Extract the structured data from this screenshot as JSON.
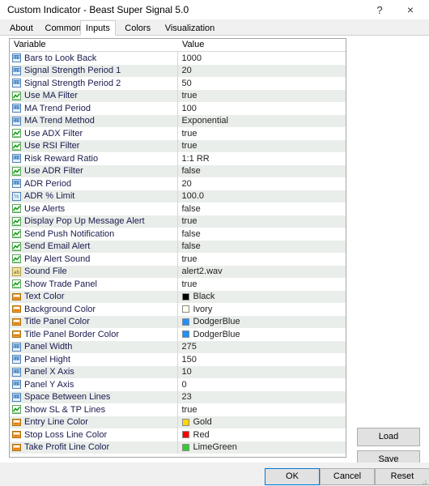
{
  "window": {
    "title": "Custom Indicator - Beast Super Signal 5.0",
    "help_label": "?",
    "close_label": "×"
  },
  "tabs": [
    {
      "label": "About",
      "active": false
    },
    {
      "label": "Common",
      "active": false
    },
    {
      "label": "Inputs",
      "active": true
    },
    {
      "label": "Colors",
      "active": false
    },
    {
      "label": "Visualization",
      "active": false
    }
  ],
  "grid": {
    "headers": {
      "variable": "Variable",
      "value": "Value"
    },
    "rows": [
      {
        "icon": "integer-icon",
        "variable": "Bars to Look Back",
        "value": "1000"
      },
      {
        "icon": "integer-icon",
        "variable": "Signal Strength Period 1",
        "value": "20"
      },
      {
        "icon": "integer-icon",
        "variable": "Signal Strength Period 2",
        "value": "50"
      },
      {
        "icon": "boolean-icon",
        "variable": "Use MA Filter",
        "value": "true"
      },
      {
        "icon": "integer-icon",
        "variable": "MA Trend Period",
        "value": "100"
      },
      {
        "icon": "integer-icon",
        "variable": "MA Trend Method",
        "value": "Exponential"
      },
      {
        "icon": "boolean-icon",
        "variable": "Use ADX Filter",
        "value": "true"
      },
      {
        "icon": "boolean-icon",
        "variable": "Use RSI Filter",
        "value": "true"
      },
      {
        "icon": "integer-icon",
        "variable": "Risk Reward Ratio",
        "value": "1:1 RR"
      },
      {
        "icon": "boolean-icon",
        "variable": "Use ADR Filter",
        "value": "false"
      },
      {
        "icon": "integer-icon",
        "variable": "ADR Period",
        "value": "20"
      },
      {
        "icon": "double-icon",
        "variable": "ADR % Limit",
        "value": "100.0"
      },
      {
        "icon": "boolean-icon",
        "variable": "Use Alerts",
        "value": "false"
      },
      {
        "icon": "boolean-icon",
        "variable": "Display Pop Up Message Alert",
        "value": "true"
      },
      {
        "icon": "boolean-icon",
        "variable": "Send Push Notification",
        "value": "false"
      },
      {
        "icon": "boolean-icon",
        "variable": "Send Email Alert",
        "value": "false"
      },
      {
        "icon": "boolean-icon",
        "variable": "Play Alert Sound",
        "value": "true"
      },
      {
        "icon": "string-icon",
        "variable": "Sound File",
        "value": "alert2.wav"
      },
      {
        "icon": "boolean-icon",
        "variable": "Show Trade Panel",
        "value": "true"
      },
      {
        "icon": "color-icon",
        "variable": "Text Color",
        "value": "Black",
        "swatch": "#000000"
      },
      {
        "icon": "color-icon",
        "variable": "Background Color",
        "value": "Ivory",
        "swatch": "#fffff0"
      },
      {
        "icon": "color-icon",
        "variable": "Title Panel Color",
        "value": "DodgerBlue",
        "swatch": "#1e90ff"
      },
      {
        "icon": "color-icon",
        "variable": "Title Panel Border Color",
        "value": "DodgerBlue",
        "swatch": "#1e90ff"
      },
      {
        "icon": "integer-icon",
        "variable": "Panel Width",
        "value": "275"
      },
      {
        "icon": "integer-icon",
        "variable": "Panel Hight",
        "value": "150"
      },
      {
        "icon": "integer-icon",
        "variable": "Panel X Axis",
        "value": "10"
      },
      {
        "icon": "integer-icon",
        "variable": "Panel Y Axis",
        "value": "0"
      },
      {
        "icon": "integer-icon",
        "variable": "Space Between Lines",
        "value": "23"
      },
      {
        "icon": "boolean-icon",
        "variable": "Show SL & TP Lines",
        "value": "true"
      },
      {
        "icon": "color-icon",
        "variable": "Entry Line Color",
        "value": "Gold",
        "swatch": "#ffd700"
      },
      {
        "icon": "color-icon",
        "variable": "Stop Loss Line Color",
        "value": "Red",
        "swatch": "#ff0000"
      },
      {
        "icon": "color-icon",
        "variable": "Take Profit Line Color",
        "value": "LimeGreen",
        "swatch": "#32cd32"
      }
    ]
  },
  "side_buttons": {
    "load": "Load",
    "save": "Save"
  },
  "footer_buttons": {
    "ok": "OK",
    "cancel": "Cancel",
    "reset": "Reset"
  }
}
